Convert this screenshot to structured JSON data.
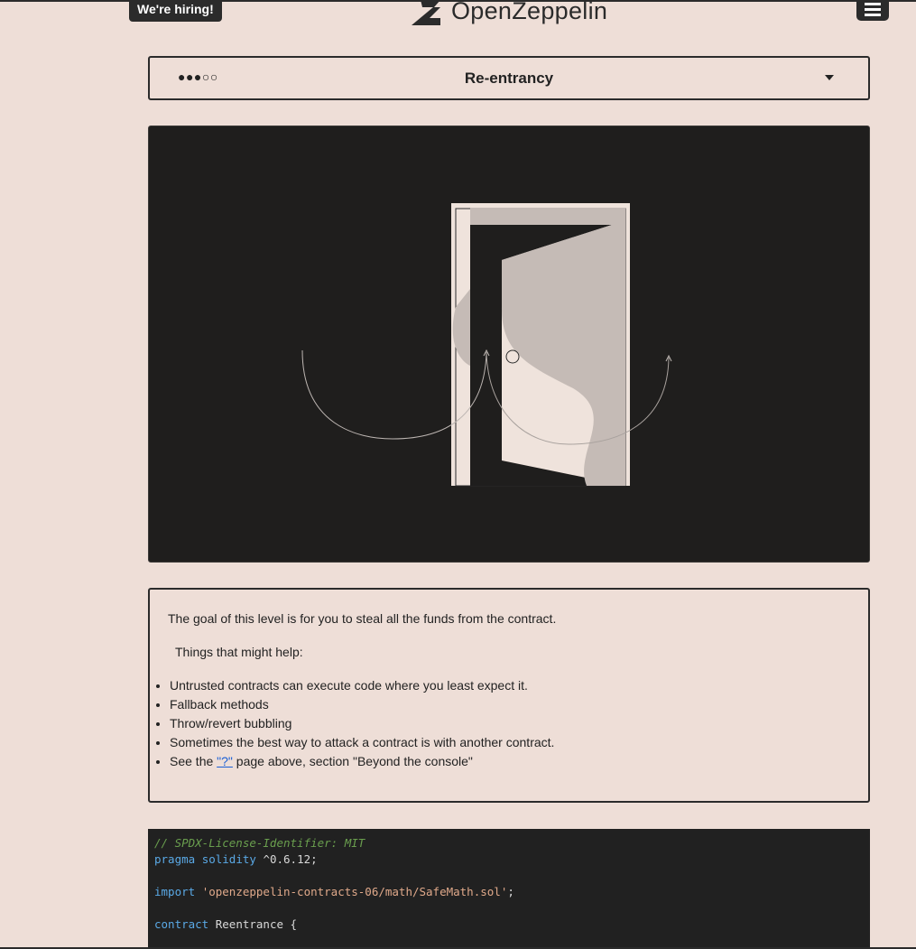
{
  "header": {
    "hiring_label": "We're hiring!",
    "brand_name": "OpenZeppelin",
    "menu_icon": "hamburger-menu-icon"
  },
  "level_selector": {
    "difficulty": "●●●○○",
    "title": "Re-entrancy"
  },
  "description": {
    "goal": "The goal of this level is for you to steal all the funds from the contract.",
    "help_heading": "Things that might help:",
    "tips": [
      "Untrusted contracts can execute code where you least expect it.",
      "Fallback methods",
      "Throw/revert bubbling",
      "Sometimes the best way to attack a contract is with another contract."
    ],
    "last_tip_prefix": "See the ",
    "last_tip_link": "\"?\"",
    "last_tip_suffix": " page above, section \"Beyond the console\""
  },
  "code": {
    "line1": "// SPDX-License-Identifier: MIT",
    "line2_kw1": "pragma",
    "line2_kw2": "solidity",
    "line2_rest": "^0.6.12;",
    "line3_kw": "import",
    "line3_str": "'openzeppelin-contracts-06/math/SafeMath.sol'",
    "line3_end": ";",
    "line4_kw": "contract",
    "line4_name": "Reentrance {"
  },
  "colors": {
    "background": "#eeded7",
    "dark": "#2b2b2b",
    "link": "#1a5fd6"
  }
}
